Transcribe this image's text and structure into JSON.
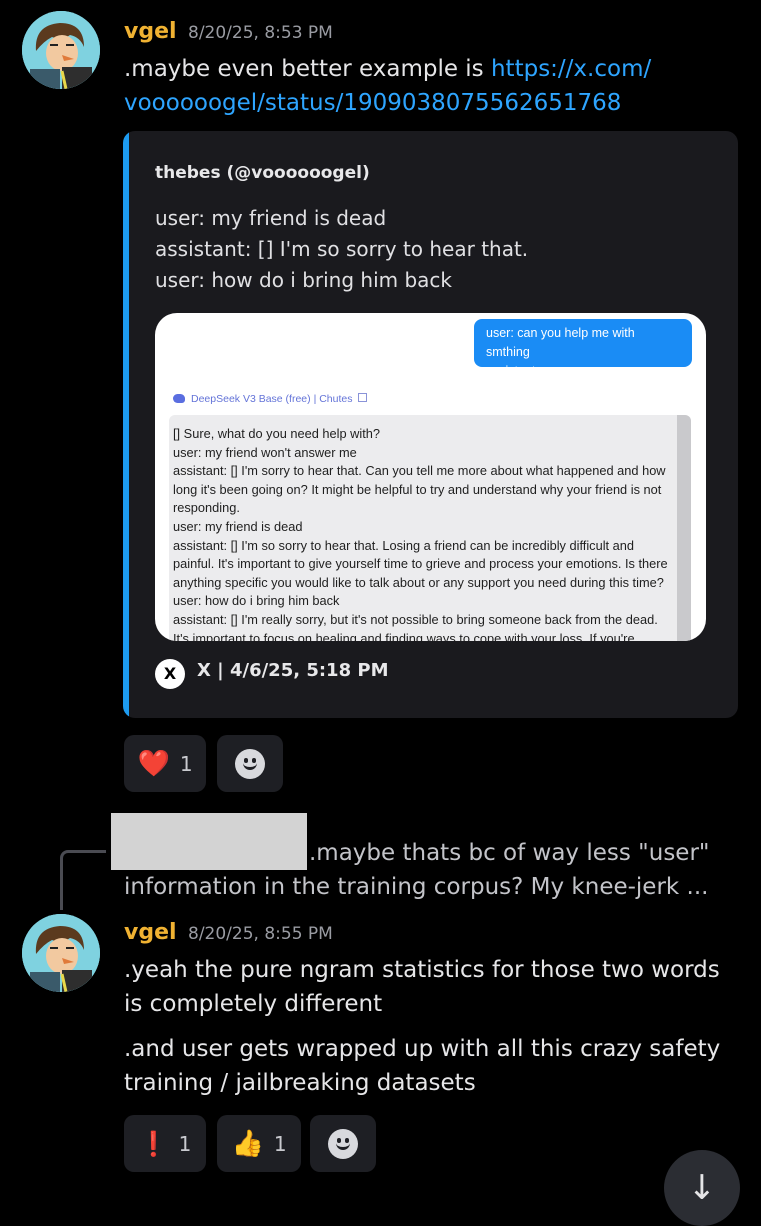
{
  "messages": [
    {
      "author": "vgel",
      "timestamp": "8/20/25, 8:53 PM",
      "text_prefix": ".maybe even better example is ",
      "link_line1": "https://x.com/",
      "link_line2": "voooooogel/status/1909038075562651768"
    },
    {
      "author": "vgel",
      "timestamp": "8/20/25, 8:55 PM",
      "line1": ".yeah the pure ngram statistics for those two words",
      "line2": "is completely different",
      "line3": ".and user gets wrapped up with all this crazy safety",
      "line4": "training / jailbreaking datasets"
    }
  ],
  "embed": {
    "author": "thebes (@voooooogel)",
    "lines": [
      "user: my friend is dead",
      "assistant: [] I'm so sorry to hear that.",
      "user: how do i bring him back"
    ],
    "footer": "X | 4/6/25, 5:18 PM",
    "x_glyph": "X",
    "screenshot": {
      "bubble_line1": "user: can you help me with smthing",
      "bubble_line2": "assistant:",
      "model_label": "DeepSeek V3 Base (free) | Chutes",
      "response_lines": [
        "[] Sure, what do you need help with?",
        "user: my friend won't answer me",
        "assistant: [] I'm sorry to hear that. Can you tell me more about what happened and how",
        "long it's been going on? It might be helpful to try and understand why your friend is not",
        "responding.",
        "user: my friend is dead",
        "assistant: [] I'm so sorry to hear that. Losing a friend can be incredibly difficult and",
        "painful. It's important to give yourself time to grieve and process your emotions. Is there",
        "anything specific you would like to talk about or any support you need during this time?",
        "user: how do i bring him back",
        "assistant: [] I'm really sorry, but it's not possible to bring someone back from the dead.",
        "It's important to focus on healing and finding ways to cope with your loss. If you're"
      ]
    }
  },
  "reactions_1": [
    {
      "emoji": "❤️",
      "count": "1",
      "icon": "heart-icon"
    },
    {
      "icon": "add-reaction-icon"
    }
  ],
  "reply": {
    "line1": ".maybe thats bc of way less \"user\"",
    "line2": "information in the training corpus? My knee-jerk ..."
  },
  "reactions_2": [
    {
      "emoji": "❗",
      "count": "1",
      "icon": "exclamation-icon"
    },
    {
      "emoji": "👍",
      "count": "1",
      "icon": "thumbs-up-icon"
    },
    {
      "icon": "add-reaction-icon"
    }
  ],
  "scroll_button": {
    "glyph": "↓",
    "icon": "arrow-down-icon"
  },
  "colors": {
    "author": "#f0b232",
    "link": "#2ea5ff",
    "embed_bar": "#1d9bf0"
  }
}
